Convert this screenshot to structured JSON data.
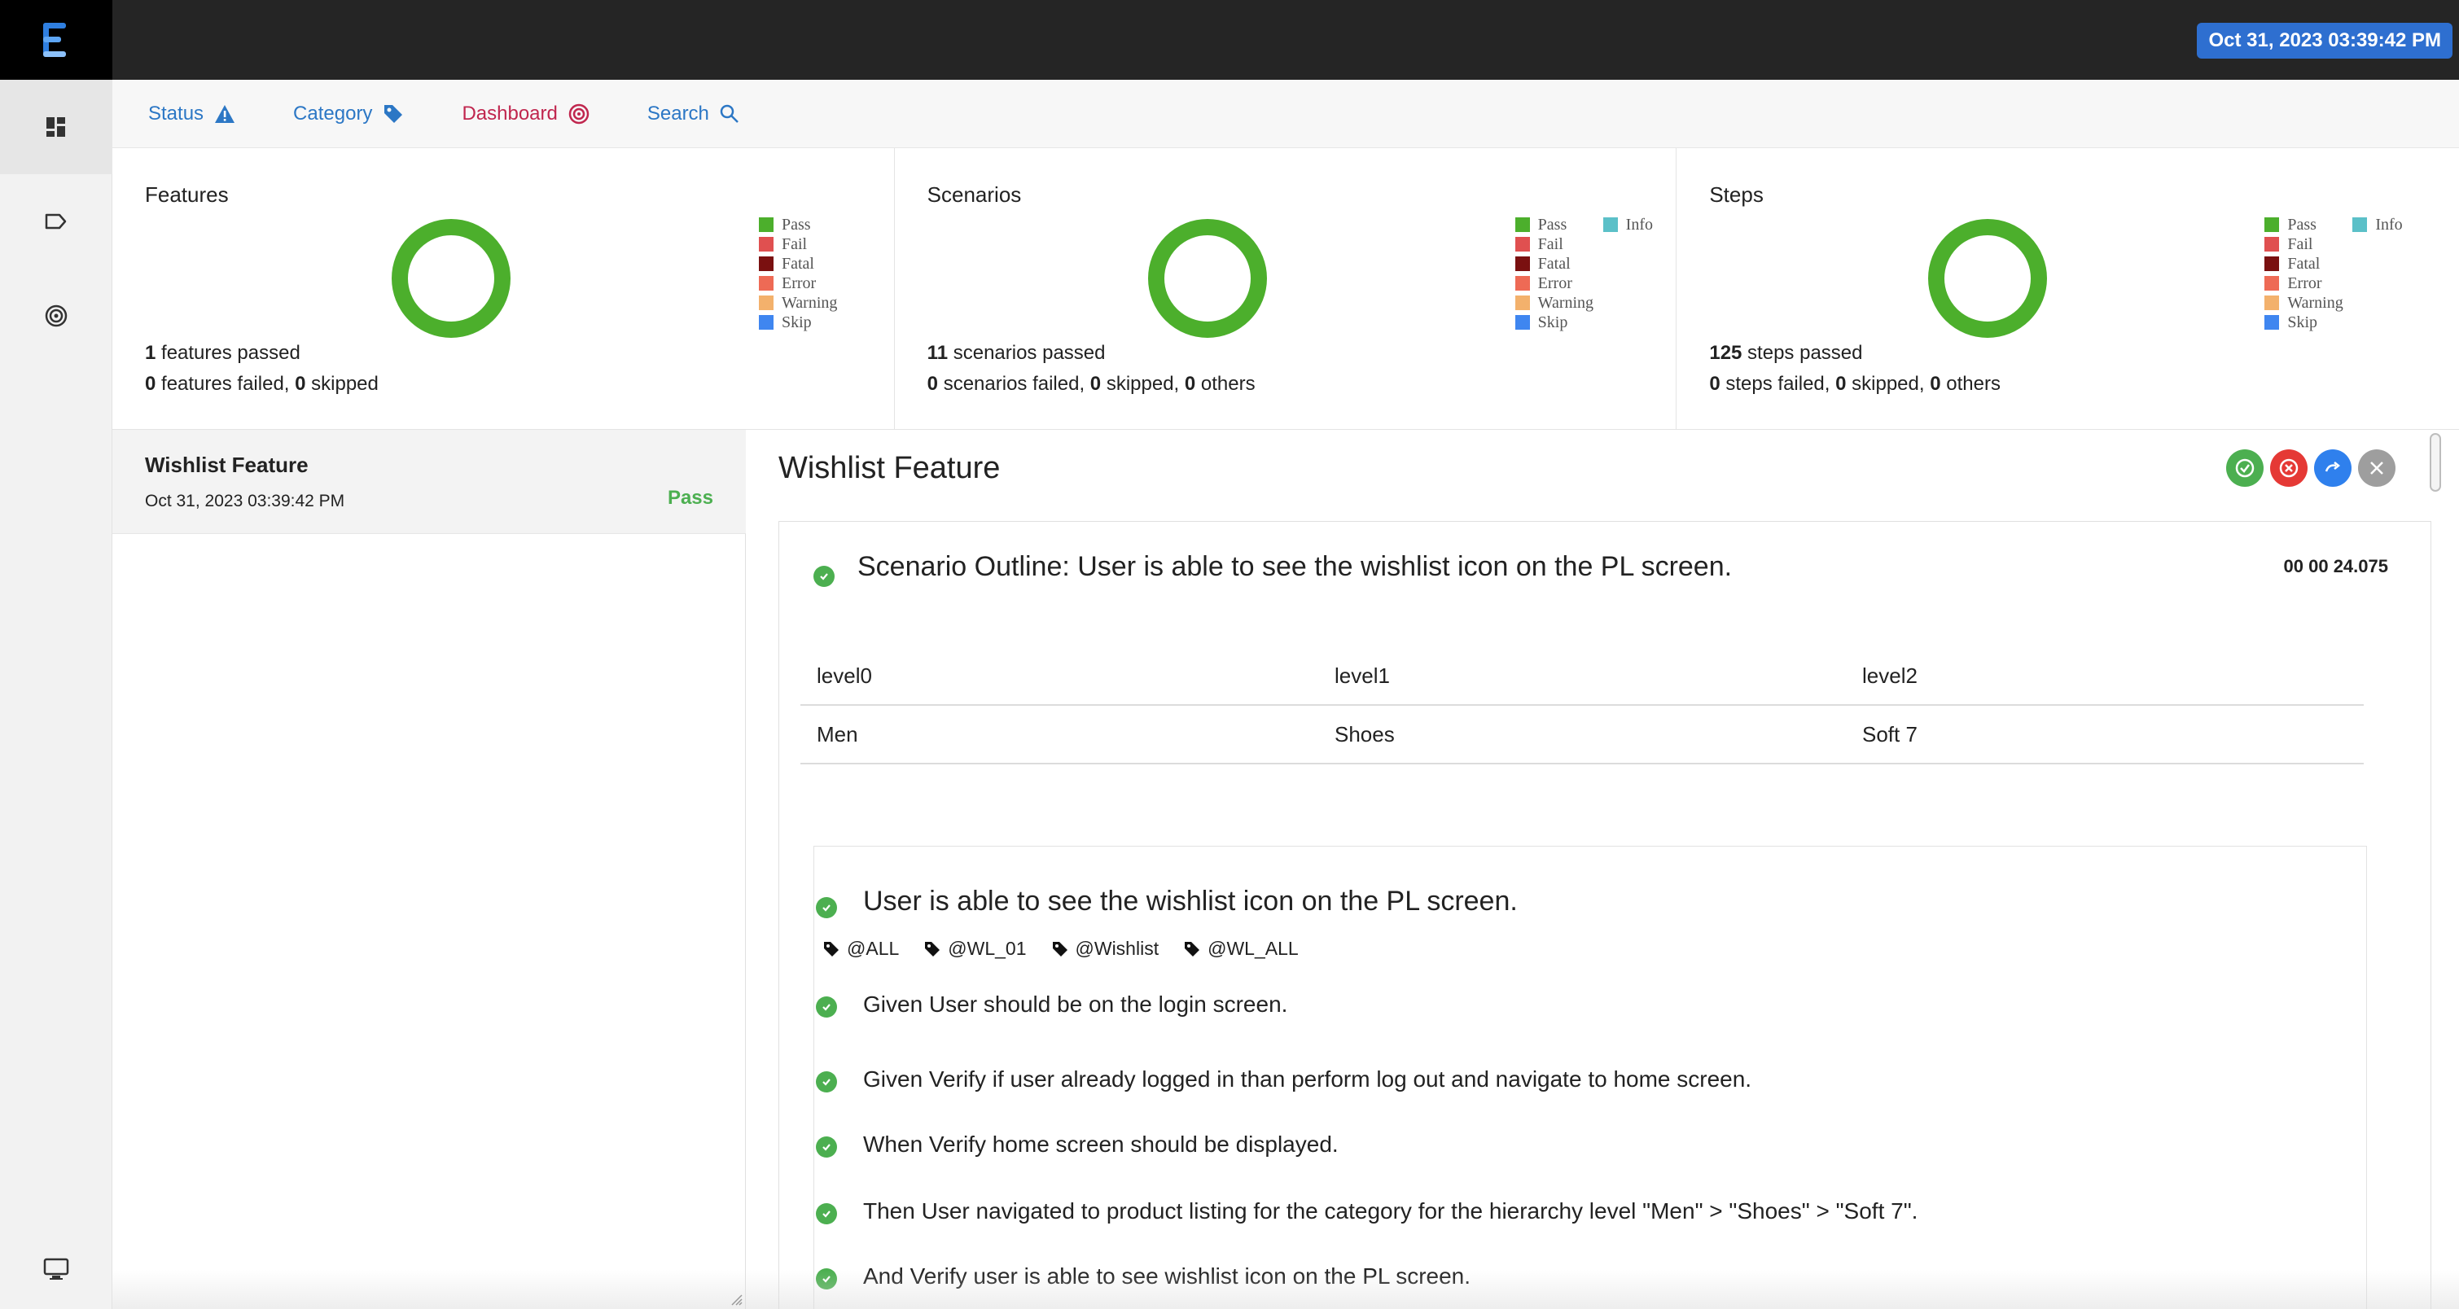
{
  "header": {
    "timestamp": "Oct 31, 2023 03:39:42 PM",
    "logo_icon": "extent-logo-icon"
  },
  "sidebar": {
    "items": [
      {
        "icon": "dashboard-grid-icon"
      },
      {
        "icon": "tag-outline-icon"
      },
      {
        "icon": "target-icon"
      },
      {
        "icon": "monitor-icon"
      }
    ]
  },
  "nav": {
    "status": "Status",
    "category": "Category",
    "dashboard": "Dashboard",
    "search": "Search"
  },
  "cards": {
    "features": {
      "title": "Features",
      "passed_count": "1",
      "passed_text": " features passed",
      "failed_count": "0",
      "failed_text": " features failed, ",
      "skipped_count": "0",
      "skipped_text": " skipped"
    },
    "scenarios": {
      "title": "Scenarios",
      "passed_count": "11",
      "passed_text": " scenarios passed",
      "failed_count": "0",
      "failed_text": " scenarios failed, ",
      "skipped_count": "0",
      "skipped_text": " skipped, ",
      "others_count": "0",
      "others_text": " others"
    },
    "steps": {
      "title": "Steps",
      "passed_count": "125",
      "passed_text": " steps passed",
      "failed_count": "0",
      "failed_text": " steps failed, ",
      "skipped_count": "0",
      "skipped_text": " skipped, ",
      "others_count": "0",
      "others_text": " others"
    },
    "legend": {
      "pass": "Pass",
      "fail": "Fail",
      "fatal": "Fatal",
      "error": "Error",
      "warning": "Warning",
      "skip": "Skip",
      "info": "Info"
    },
    "colors": {
      "pass": "#4caf2c",
      "fail": "#e05050",
      "fatal": "#7a1010",
      "error": "#ee6a55",
      "warning": "#f3b16c",
      "skip": "#3f86f0",
      "info": "#5bc0c8"
    }
  },
  "feature_list": {
    "items": [
      {
        "name": "Wishlist Feature",
        "date": "Oct 31, 2023 03:39:42 PM",
        "status": "Pass"
      }
    ]
  },
  "detail": {
    "title": "Wishlist Feature",
    "scenario": {
      "title": "Scenario Outline: User is able to see the wishlist icon on the PL screen.",
      "duration": "00 00 24.075",
      "examples": {
        "headers": [
          "level0",
          "level1",
          "level2"
        ],
        "rows": [
          [
            "Men",
            "Shoes",
            "Soft 7"
          ]
        ]
      },
      "inner": {
        "title": "User is able to see the wishlist icon on the PL screen.",
        "tags": [
          "@ALL",
          "@WL_01",
          "@Wishlist",
          "@WL_ALL"
        ],
        "steps": [
          "Given User should be on the login screen.",
          "Given Verify if user already logged in than perform log out and navigate to home screen.",
          "When Verify home screen should be displayed.",
          "Then User navigated to product listing for the category for the hierarchy level \"Men\" > \"Shoes\" > \"Soft 7\".",
          "And Verify user is able to see wishlist icon on the PL screen."
        ]
      }
    }
  }
}
